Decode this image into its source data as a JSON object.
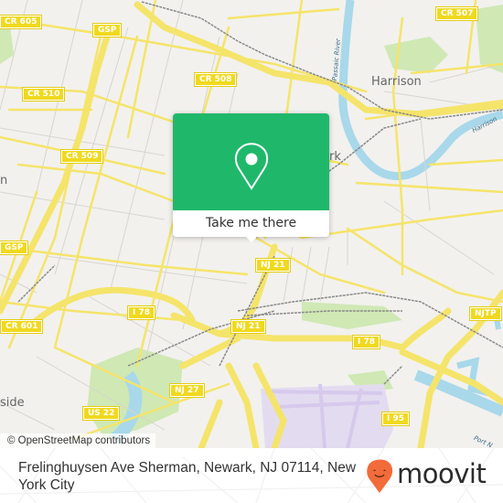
{
  "map": {
    "attribution": "© OpenStreetMap contributors",
    "colors": {
      "land": "#f2f1ee",
      "road_major": "#f5e46a",
      "road_minor": "#ffffff",
      "water": "#a8d8ea",
      "park": "#c8e6a8",
      "rail": "#888888",
      "airport": "#e5dcf0"
    },
    "road_shields": [
      {
        "id": "cr605",
        "label": "CR 605"
      },
      {
        "id": "gsp1",
        "label": "GSP"
      },
      {
        "id": "cr508",
        "label": "CR 508"
      },
      {
        "id": "cr507",
        "label": "CR 507"
      },
      {
        "id": "cr510",
        "label": "CR 510"
      },
      {
        "id": "cr509",
        "label": "CR 509"
      },
      {
        "id": "gsp2",
        "label": "GSP"
      },
      {
        "id": "nj21a",
        "label": "NJ 21"
      },
      {
        "id": "i78a",
        "label": "I 78"
      },
      {
        "id": "cr601",
        "label": "CR 601"
      },
      {
        "id": "nj21b",
        "label": "NJ 21"
      },
      {
        "id": "i78b",
        "label": "I 78"
      },
      {
        "id": "njtp",
        "label": "NJTP"
      },
      {
        "id": "nj27",
        "label": "NJ 27"
      },
      {
        "id": "us22",
        "label": "US 22"
      },
      {
        "id": "i95",
        "label": "I 95"
      }
    ],
    "places": {
      "harrison": "Harrison",
      "newark_partial": "rk",
      "hillside_partial": "side",
      "left_partial": "n"
    },
    "water_labels": {
      "passaic": "Passaic River",
      "harrison_reach": "Harrison",
      "port_newark": "Port N"
    }
  },
  "popup": {
    "icon": "map-pin-icon",
    "action_label": "Take me there",
    "accent": "#1fb86a"
  },
  "footer": {
    "address": "Frelinghuysen Ave Sherman, Newark, NJ 07114, New York City",
    "brand": "moovit",
    "brand_icon": "moovit-pin-icon",
    "brand_color": "#f26b3a"
  }
}
